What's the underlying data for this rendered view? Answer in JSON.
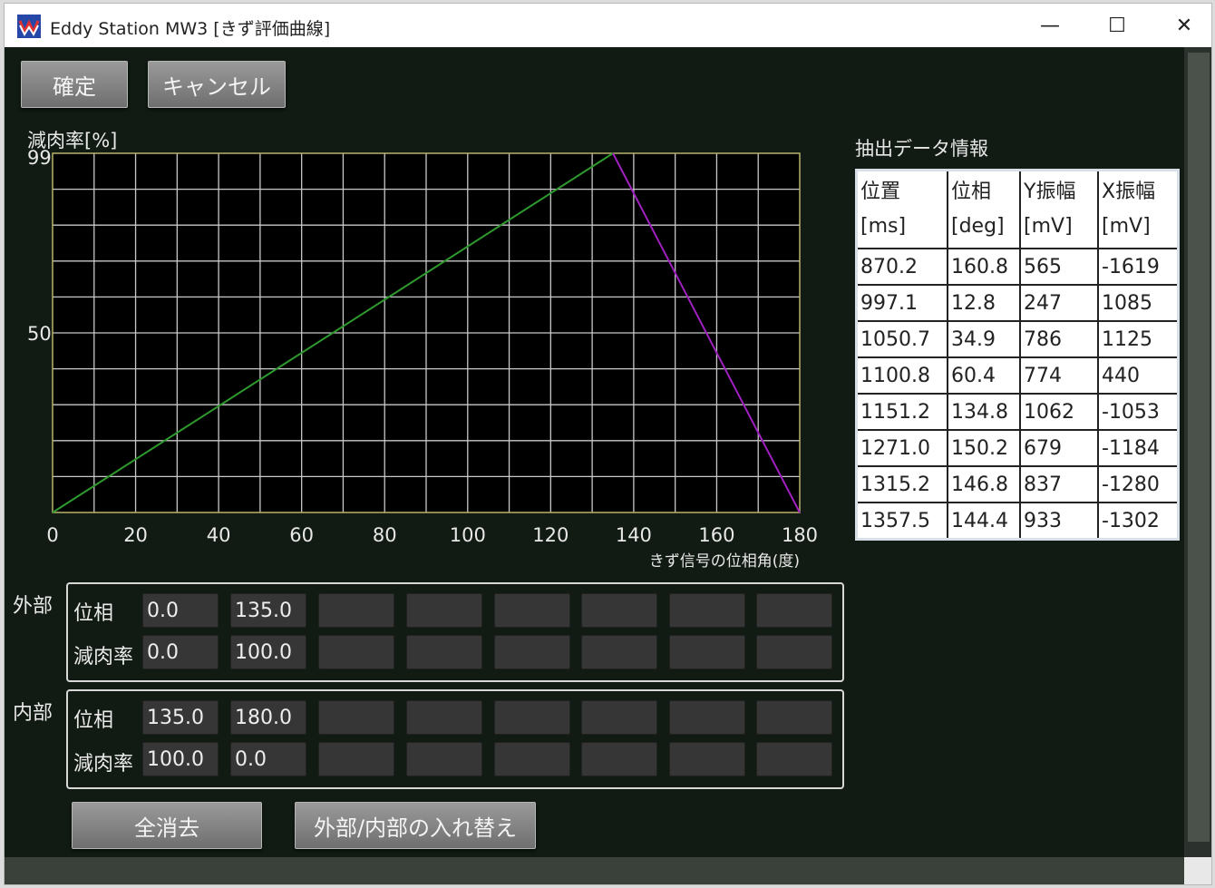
{
  "window": {
    "title": "Eddy Station MW3 [きず評価曲線]",
    "minimize": "—",
    "maximize": "☐",
    "close": "✕"
  },
  "toolbar": {
    "confirm_label": "確定",
    "cancel_label": "キャンセル"
  },
  "chart_data": {
    "type": "line",
    "ylabel": "減肉率[%]",
    "xlabel": "きず信号の位相角(度)",
    "xlim": [
      0,
      180
    ],
    "ylim": [
      0,
      100
    ],
    "x_ticks": [
      "0",
      "20",
      "40",
      "60",
      "80",
      "100",
      "120",
      "140",
      "160",
      "180"
    ],
    "y_ticks": [
      {
        "value": 99,
        "label": "99"
      },
      {
        "value": 50,
        "label": "50"
      }
    ],
    "grid": true,
    "series": [
      {
        "color": "#2e9a2e",
        "points": [
          [
            0,
            0
          ],
          [
            135,
            100
          ]
        ]
      },
      {
        "color": "#a020c0",
        "points": [
          [
            135,
            100
          ],
          [
            180,
            0
          ]
        ]
      }
    ]
  },
  "extracted": {
    "title": "抽出データ情報",
    "headers": [
      {
        "l1": "位置",
        "l2": "[ms]"
      },
      {
        "l1": "位相",
        "l2": "[deg]"
      },
      {
        "l1": "Y振幅",
        "l2": "[mV]"
      },
      {
        "l1": "X振幅",
        "l2": "[mV]"
      }
    ],
    "rows": [
      [
        "870.2",
        "160.8",
        "565",
        "-1619"
      ],
      [
        "997.1",
        "12.8",
        "247",
        "1085"
      ],
      [
        "1050.7",
        "34.9",
        "786",
        "1125"
      ],
      [
        "1100.8",
        "60.4",
        "774",
        "440"
      ],
      [
        "1151.2",
        "134.8",
        "1062",
        "-1053"
      ],
      [
        "1271.0",
        "150.2",
        "679",
        "-1184"
      ],
      [
        "1315.2",
        "146.8",
        "837",
        "-1280"
      ],
      [
        "1357.5",
        "144.4",
        "933",
        "-1302"
      ]
    ]
  },
  "outer": {
    "label": "外部",
    "phase_label": "位相",
    "thinning_label": "減肉率",
    "phase": [
      "0.0",
      "135.0",
      "",
      "",
      "",
      "",
      "",
      ""
    ],
    "thinning": [
      "0.0",
      "100.0",
      "",
      "",
      "",
      "",
      "",
      ""
    ]
  },
  "inner": {
    "label": "内部",
    "phase_label": "位相",
    "thinning_label": "減肉率",
    "phase": [
      "135.0",
      "180.0",
      "",
      "",
      "",
      "",
      "",
      ""
    ],
    "thinning": [
      "100.0",
      "0.0",
      "",
      "",
      "",
      "",
      "",
      ""
    ]
  },
  "bottom": {
    "clear_all_label": "全消去",
    "swap_label": "外部/内部の入れ替え"
  }
}
